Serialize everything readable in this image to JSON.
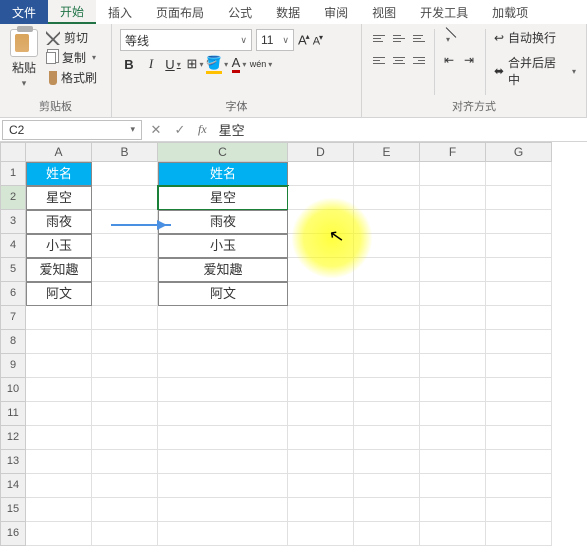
{
  "tabs": {
    "file": "文件",
    "home": "开始",
    "insert": "插入",
    "layout": "页面布局",
    "formula": "公式",
    "data": "数据",
    "review": "审阅",
    "view": "视图",
    "dev": "开发工具",
    "addin": "加载项"
  },
  "ribbon": {
    "clipboard": {
      "paste": "粘贴",
      "cut": "剪切",
      "copy": "复制",
      "brush": "格式刷",
      "label": "剪贴板"
    },
    "font": {
      "name": "等线",
      "size": "11",
      "label": "字体",
      "increase": "A",
      "decrease": "A",
      "bold": "B",
      "italic": "I",
      "underline": "U",
      "wenzi": "wén"
    },
    "align": {
      "label": "对齐方式",
      "wrap": "自动换行",
      "merge": "合并后居中"
    }
  },
  "namebox": {
    "ref": "C2",
    "value": "星空"
  },
  "cols": [
    "A",
    "B",
    "C",
    "D",
    "E",
    "F",
    "G"
  ],
  "rows": [
    "1",
    "2",
    "3",
    "4",
    "5",
    "6",
    "7",
    "8",
    "9",
    "10",
    "11",
    "12",
    "13",
    "14",
    "15",
    "16"
  ],
  "data": {
    "A1": "姓名",
    "A2": "星空",
    "A3": "雨夜",
    "A4": "小玉",
    "A5": "爱知趣",
    "A6": "阿文",
    "C1": "姓名",
    "C2": "星空",
    "C3": "雨夜",
    "C4": "小玉",
    "C5": "爱知趣",
    "C6": "阿文"
  }
}
